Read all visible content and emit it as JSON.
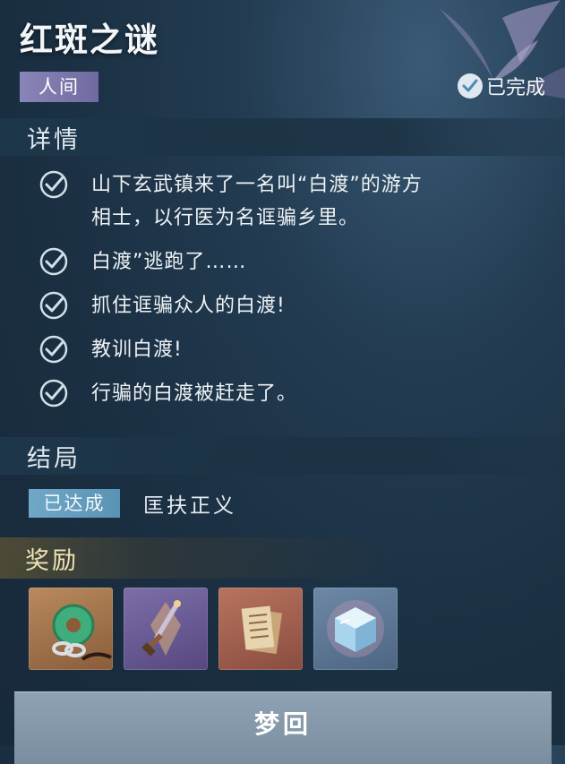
{
  "quest": {
    "title": "红斑之谜",
    "realm_tag": "人间",
    "status": "已完成"
  },
  "details": {
    "section_title": "详情",
    "tasks": [
      {
        "text_line1": "山下玄武镇来了一名叫“白渡”的游方",
        "text_line2": "相士，以行医为名诓骗乡里。"
      },
      {
        "text_line1": "白渡”逃跑了……",
        "text_line2": ""
      },
      {
        "text_line1": "抓住诓骗众人的白渡!",
        "text_line2": ""
      },
      {
        "text_line1": "教训白渡!",
        "text_line2": ""
      },
      {
        "text_line1": "行骗的白渡被赶走了。",
        "text_line2": ""
      }
    ]
  },
  "ending": {
    "section_title": "结局",
    "badge": "已达成",
    "text": "匡扶正义"
  },
  "rewards": {
    "section_title": "奖励",
    "items": [
      {
        "icon": "jade-pendant-icon",
        "rarity_color": "#b98a5d"
      },
      {
        "icon": "dagger-icon",
        "rarity_color": "#7d6ea8"
      },
      {
        "icon": "scroll-book-icon",
        "rarity_color": "#b8735f"
      },
      {
        "icon": "crystal-cube-icon",
        "rarity_color": "#6d88a6"
      }
    ]
  },
  "action": {
    "label": "梦回"
  }
}
